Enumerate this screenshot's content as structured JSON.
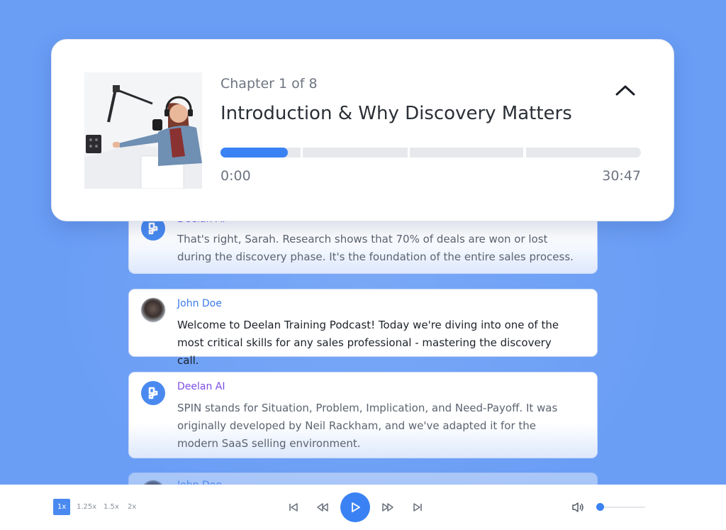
{
  "player": {
    "chapter_label": "Chapter 1 of 8",
    "chapter_title": "Introduction & Why Discovery Matters",
    "time_current": "0:00",
    "time_total": "30:47",
    "progress_fraction": 0.16,
    "cover_icon": "podcast-host-image"
  },
  "transcript": [
    {
      "speaker": "Deelan AI",
      "text": "That's right, Sarah. Research shows that 70% of deals are won or lost during the discovery phase. It's the foundation of the entire sales process."
    },
    {
      "speaker": "John Doe",
      "text": "Welcome to Deelan Training Podcast! Today we're diving into one of the most critical skills for any sales professional - mastering the discovery call."
    },
    {
      "speaker": "Deelan AI",
      "text": "SPIN stands for Situation, Problem, Implication, and Need-Payoff. It was originally developed by Neil Rackham, and we've adapted it for the modern SaaS selling environment."
    },
    {
      "speaker": "John Doe",
      "text": ""
    }
  ],
  "controls": {
    "speeds": [
      "1x",
      "1.25x",
      "1.5x",
      "2x"
    ],
    "selected_speed": "1x",
    "volume_fraction": 0.05
  },
  "colors": {
    "accent": "#3a82f4",
    "background": "#6a9ef5",
    "ai_name": "#7c4ee4",
    "user_name": "#3b7ae8"
  }
}
